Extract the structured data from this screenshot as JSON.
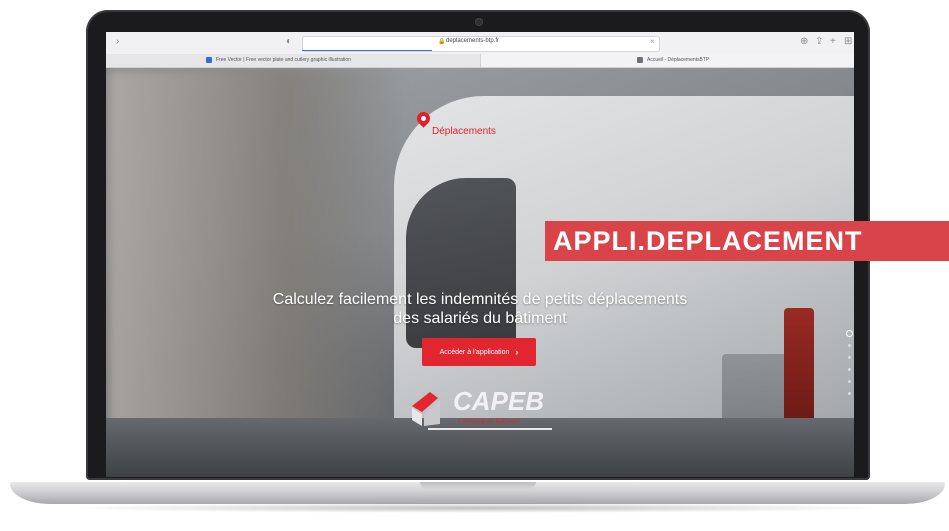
{
  "browser": {
    "url": "deplacements-btp.fr",
    "tabs": [
      {
        "label": "Free Vector | Free vector plate and cutlery graphic illustration",
        "favicon_color": "#2f6de0"
      },
      {
        "label": "Accueil - DéplacementsBTP",
        "favicon_color": "#707078"
      }
    ]
  },
  "site": {
    "logo_text": "Déplacements",
    "headline_line1": "Calculez facilement les indemnités de petits déplacements",
    "headline_line2": "des salariés du bâtiment",
    "cta_label": "Accéder à l'application",
    "partner_name": "CAPEB",
    "partner_tagline": "L'artisanat du Bâtiment"
  },
  "banner": {
    "text": "APPLI.DEPLACEMENT"
  },
  "colors": {
    "brand_red": "#e31f2b",
    "banner_red": "#d9444a"
  },
  "slider": {
    "count": 6,
    "active": 1
  }
}
